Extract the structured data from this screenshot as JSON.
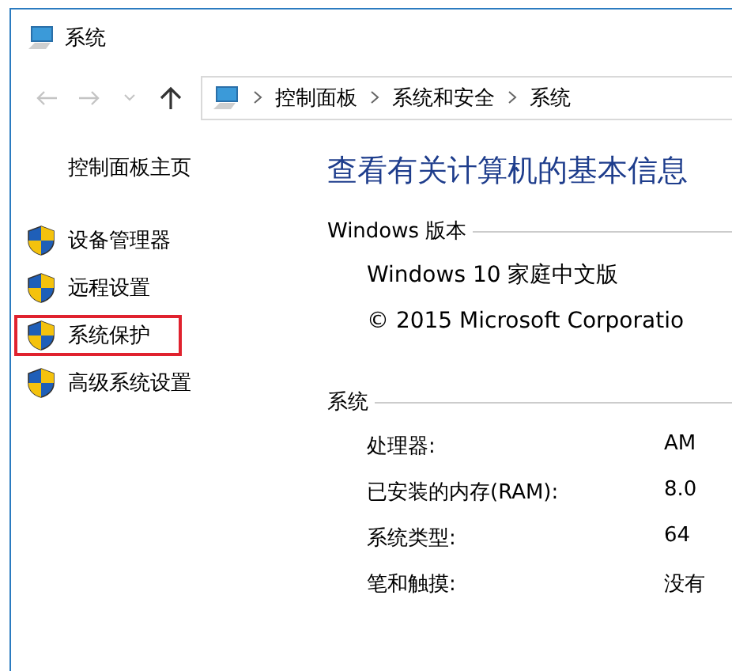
{
  "window": {
    "title": "系统"
  },
  "breadcrumb": [
    "控制面板",
    "系统和安全",
    "系统"
  ],
  "sidebar": {
    "home": "控制面板主页",
    "items": [
      {
        "label": "设备管理器",
        "highlighted": false
      },
      {
        "label": "远程设置",
        "highlighted": false
      },
      {
        "label": "系统保护",
        "highlighted": true
      },
      {
        "label": "高级系统设置",
        "highlighted": false
      }
    ]
  },
  "main": {
    "heading": "查看有关计算机的基本信息",
    "sections": [
      {
        "title": "Windows 版本",
        "kind": "lines",
        "rows": [
          {
            "label": "Windows 10 家庭中文版"
          },
          {
            "label": "© 2015 Microsoft Corporatio"
          }
        ]
      },
      {
        "title": "系统",
        "kind": "pairs",
        "rows": [
          {
            "label": "处理器:",
            "value": "AM"
          },
          {
            "label": "已安装的内存(RAM):",
            "value": "8.0"
          },
          {
            "label": "系统类型:",
            "value": "64"
          },
          {
            "label": "笔和触摸:",
            "value": "没有"
          }
        ]
      }
    ]
  }
}
